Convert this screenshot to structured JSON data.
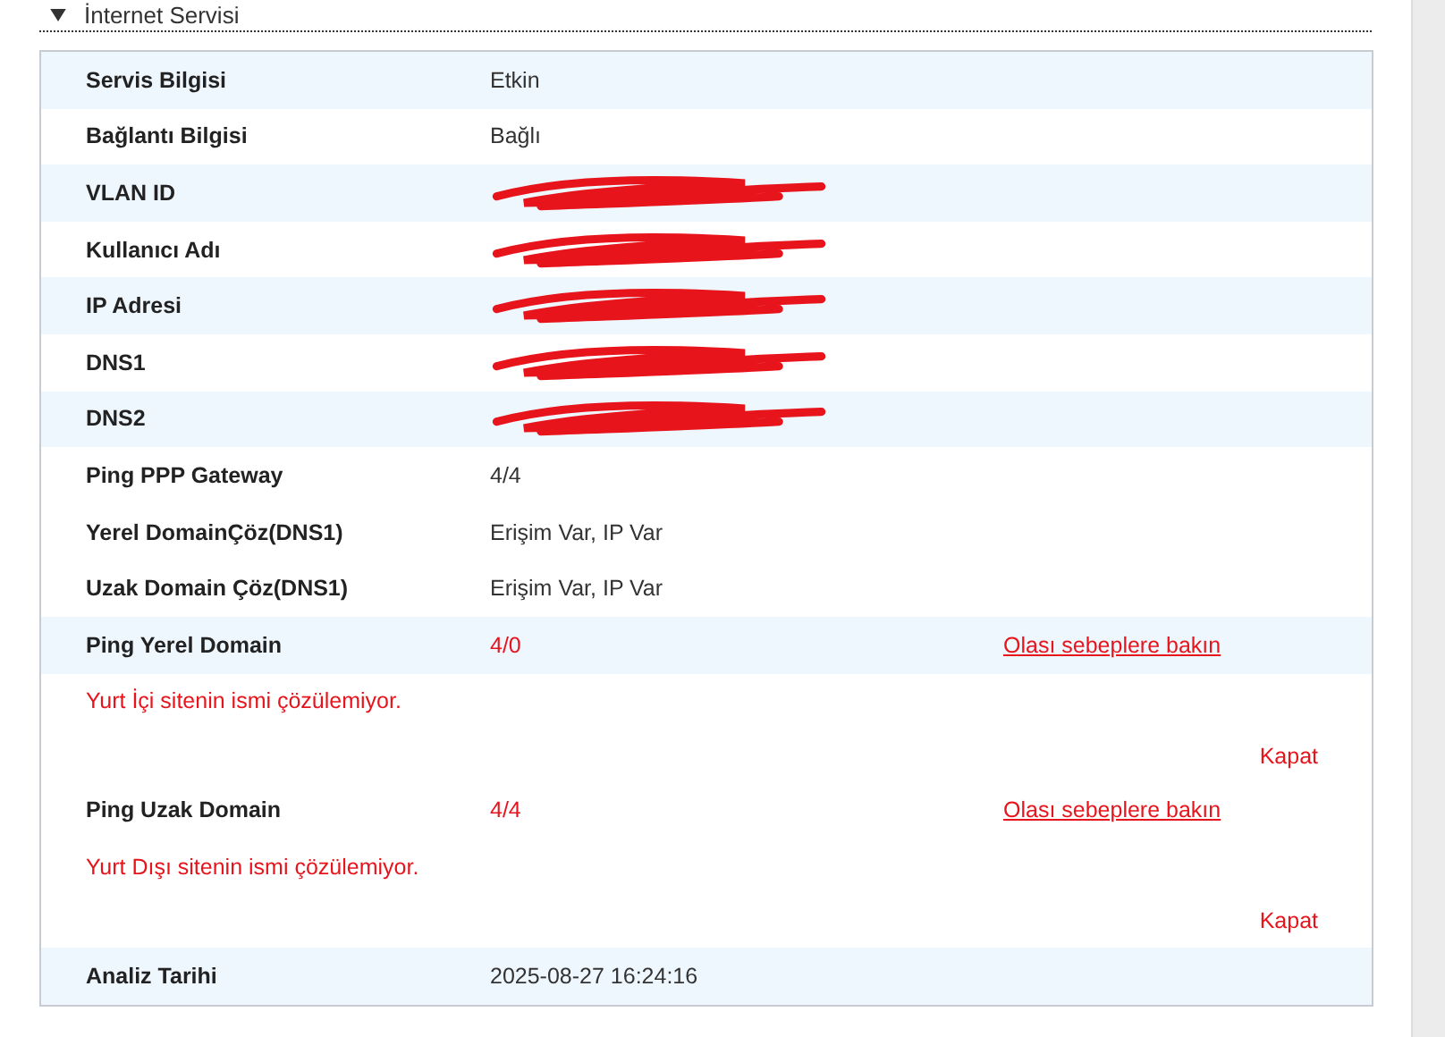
{
  "section": {
    "title": "İnternet Servisi",
    "expanded": true
  },
  "rows": [
    {
      "kind": "plain",
      "label": "Servis Bilgisi",
      "value": "Etkin",
      "shaded": true
    },
    {
      "kind": "plain",
      "label": "Bağlantı Bilgisi",
      "value": "Bağlı",
      "shaded": false
    },
    {
      "kind": "redacted",
      "label": "VLAN ID",
      "shaded": true
    },
    {
      "kind": "redacted",
      "label": "Kullanıcı Adı",
      "shaded": false
    },
    {
      "kind": "redacted",
      "label": "IP Adresi",
      "shaded": true
    },
    {
      "kind": "redacted",
      "label": "DNS1",
      "shaded": false
    },
    {
      "kind": "redacted",
      "label": "DNS2",
      "shaded": true
    },
    {
      "kind": "plain",
      "label": "Ping PPP Gateway",
      "value": "4/4",
      "shaded": false
    },
    {
      "kind": "plain",
      "label": "Yerel DomainÇöz(DNS1)",
      "value": "Erişim Var, IP Var",
      "shaded": false
    },
    {
      "kind": "plain",
      "label": "Uzak Domain Çöz(DNS1)",
      "value": "Erişim Var, IP Var",
      "shaded": false
    },
    {
      "kind": "alert",
      "label": "Ping Yerel Domain",
      "value": "4/0",
      "shaded": true,
      "link": "Olası sebeplere bakın",
      "message": "Yurt İçi sitenin ismi çözülemiyor.",
      "close": "Kapat"
    },
    {
      "kind": "alert",
      "label": "Ping Uzak Domain",
      "value": "4/4",
      "shaded": false,
      "link": "Olası sebeplere bakın",
      "message": "Yurt Dışı sitenin ismi çözülemiyor.",
      "close": "Kapat"
    },
    {
      "kind": "plain",
      "label": "Analiz Tarihi",
      "value": "2025-08-27 16:24:16",
      "shaded": true
    }
  ]
}
